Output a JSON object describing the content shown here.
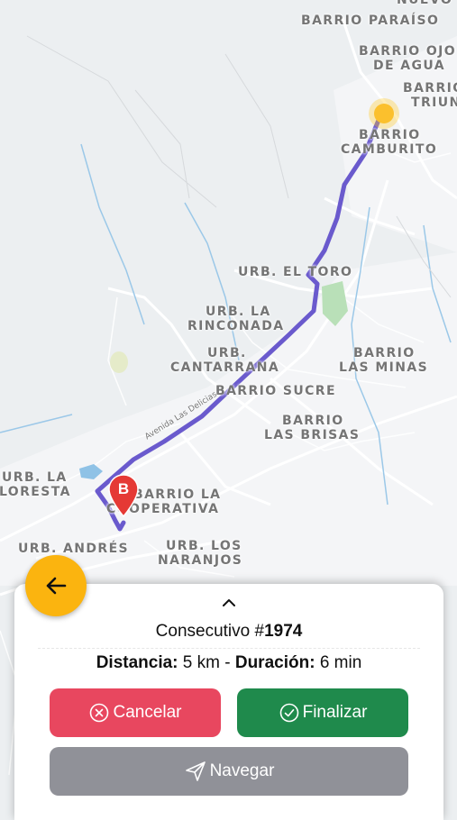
{
  "map": {
    "labels": [
      "NUEVO",
      "BARRIO PARAÍSO",
      "BARRIO OJO",
      "DE AGUA",
      "BARRIO",
      "TRIUN",
      "BARRIO",
      "CAMBURITO",
      "URB. EL TORO",
      "URB. LA",
      "RINCONADA",
      "URB.",
      "CANTARRANA",
      "BARRIO",
      "LAS MINAS",
      "BARRIO SUCRE",
      "BARRIO",
      "LAS BRISAS",
      "URB. LA",
      "FLORESTA",
      "BARRIO LA",
      "COOPERATIVA",
      "URB. ANDRÉS",
      "URB. LOS",
      "NARANJOS",
      "Avenida Las Delicias"
    ],
    "destination_marker": "B",
    "route_color": "#6a5acd",
    "origin_color": "#fbc02d"
  },
  "back_button": {
    "icon": "arrow-left-icon",
    "color": "#fbb40f"
  },
  "panel": {
    "consecutivo_prefix": "Consecutivo #",
    "consecutivo_number": "1974",
    "distance_label": "Distancia:",
    "distance_value": "5 km",
    "separator": "-",
    "duration_label": "Duración:",
    "duration_value": "6 min",
    "cancel_label": "Cancelar",
    "finish_label": "Finalizar",
    "navigate_label": "Navegar",
    "colors": {
      "cancel": "#e8475f",
      "finish": "#1f8a4c",
      "navigate": "#909198"
    }
  }
}
